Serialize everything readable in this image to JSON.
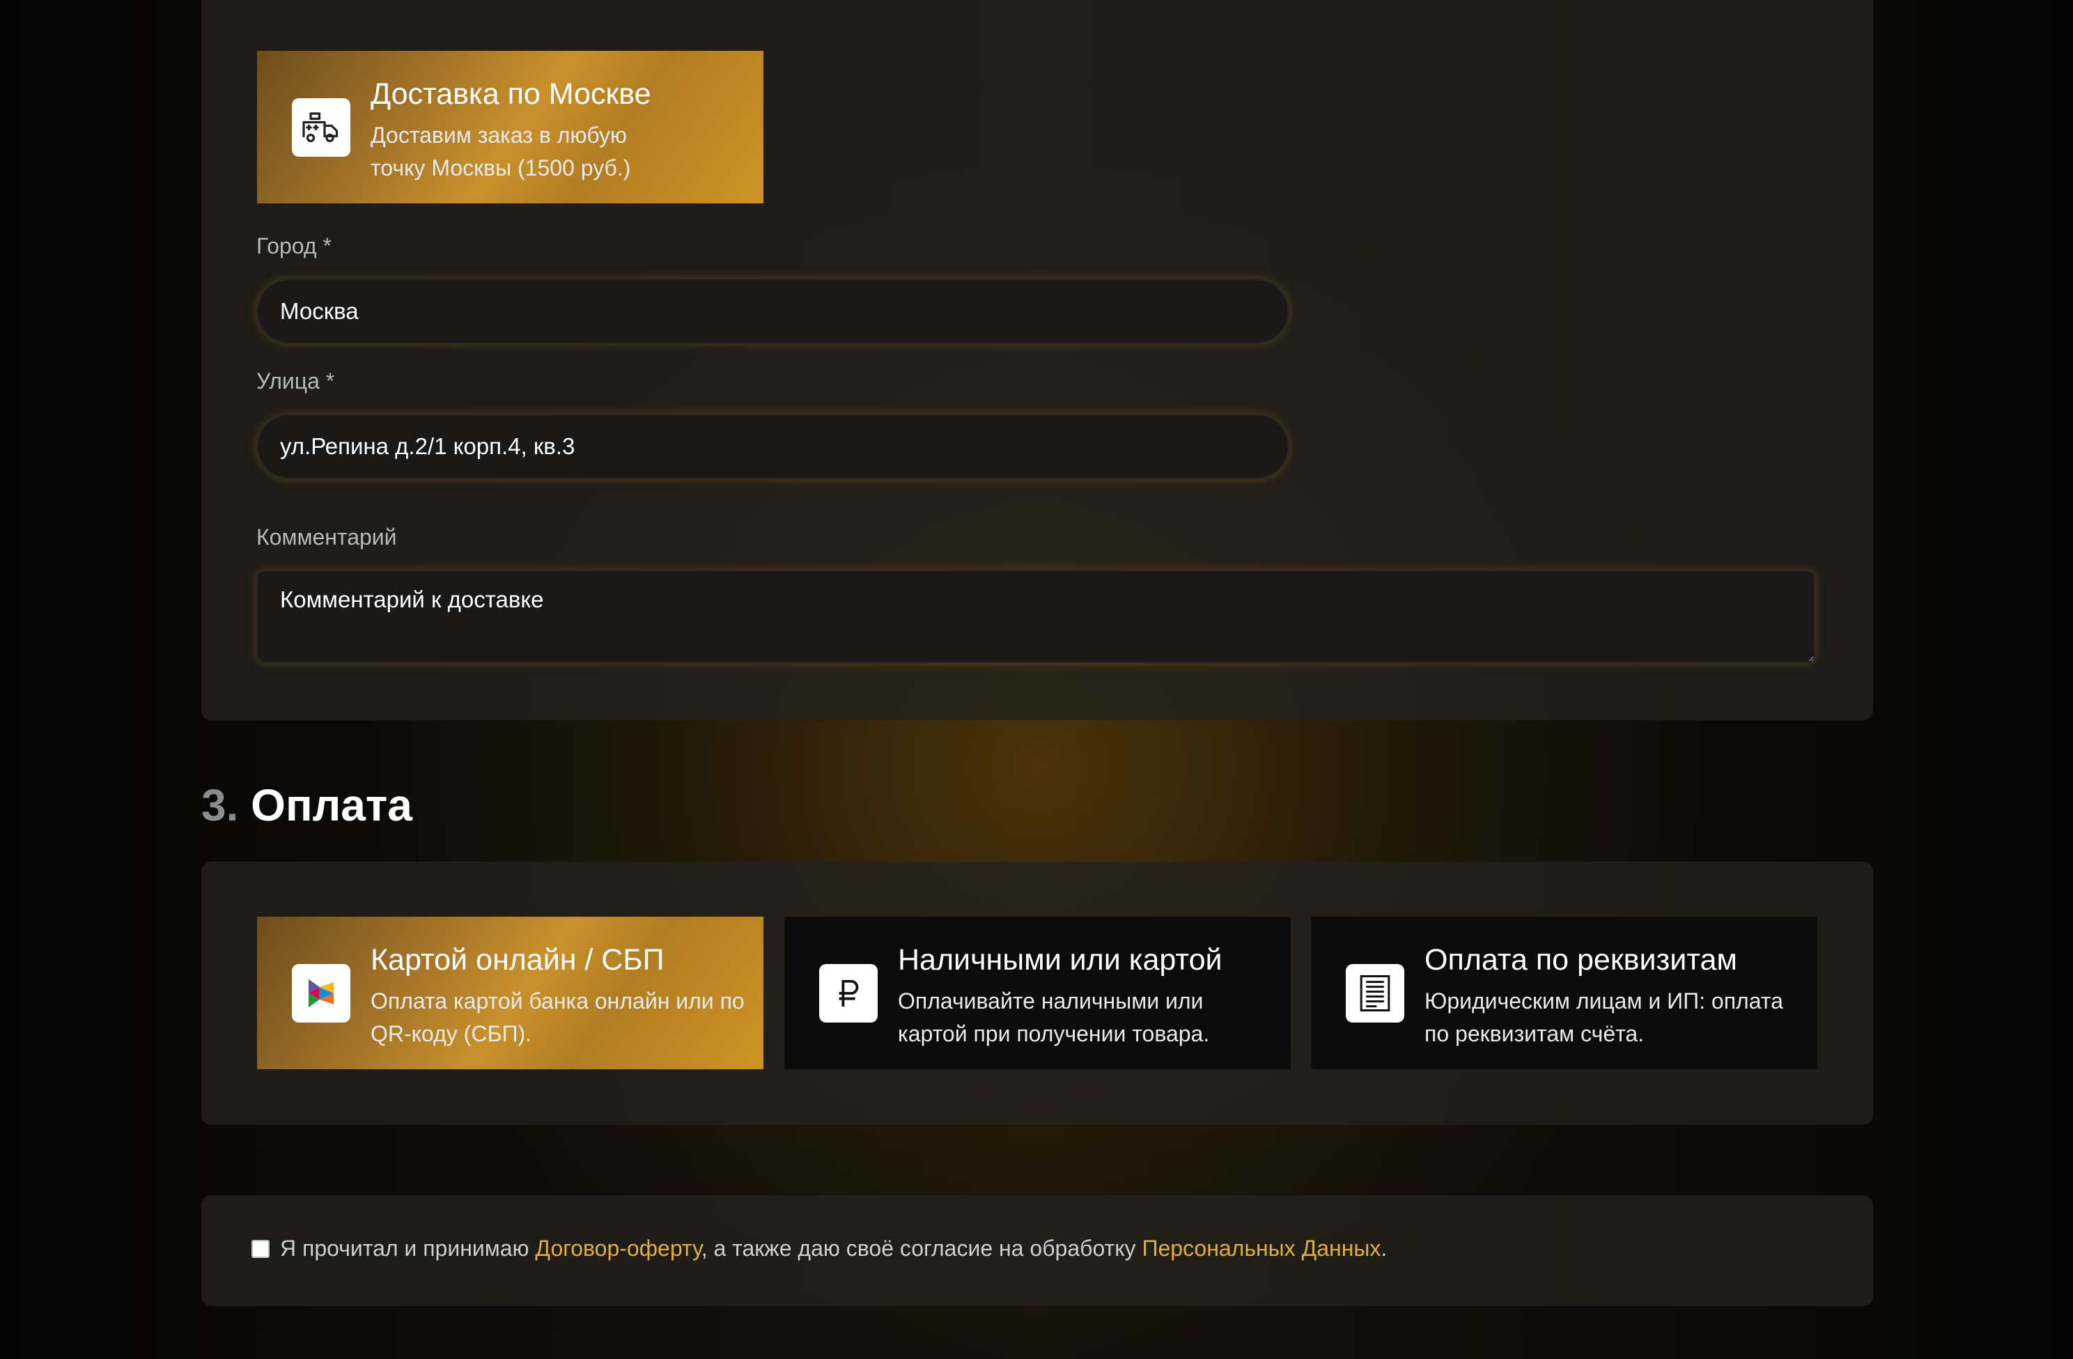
{
  "delivery": {
    "option": {
      "title": "Доставка по Москве",
      "description": "Доставим заказ в любую точку Москвы (1500 руб.)",
      "icon": "truck-icon",
      "selected": true
    },
    "city": {
      "label": "Город *",
      "value": "Москва"
    },
    "street": {
      "label": "Улица *",
      "value": "ул.Репина д.2/1 корп.4, кв.3"
    },
    "comment": {
      "label": "Комментарий",
      "placeholder": "Комментарий к доставке"
    }
  },
  "payment": {
    "number": "3.",
    "title": "Оплата",
    "options": [
      {
        "title": "Картой онлайн / СБП",
        "description": "Оплата картой банка онлайн или по QR-коду (СБП).",
        "icon": "sbp-icon",
        "selected": true
      },
      {
        "title": "Наличными или картой",
        "description": "Оплачивайте наличными или картой при получении товара.",
        "icon": "ruble-icon",
        "selected": false
      },
      {
        "title": "Оплата по реквизитам",
        "description": "Юридическим лицам и ИП: оплата по реквизитам счёта.",
        "icon": "document-icon",
        "selected": false
      }
    ]
  },
  "consent": {
    "checked": false,
    "text_before": "Я прочитал и принимаю ",
    "offer_link": "Договор-оферту",
    "text_middle": ", а также даю своё согласие на обработку ",
    "personal_data_link": "Персональных Данных",
    "text_after": "."
  },
  "colors": {
    "accent_gold": "#c9912c",
    "link_gold": "#e0b13a",
    "panel": "#24211e",
    "card_dark": "#0c0c0d"
  }
}
